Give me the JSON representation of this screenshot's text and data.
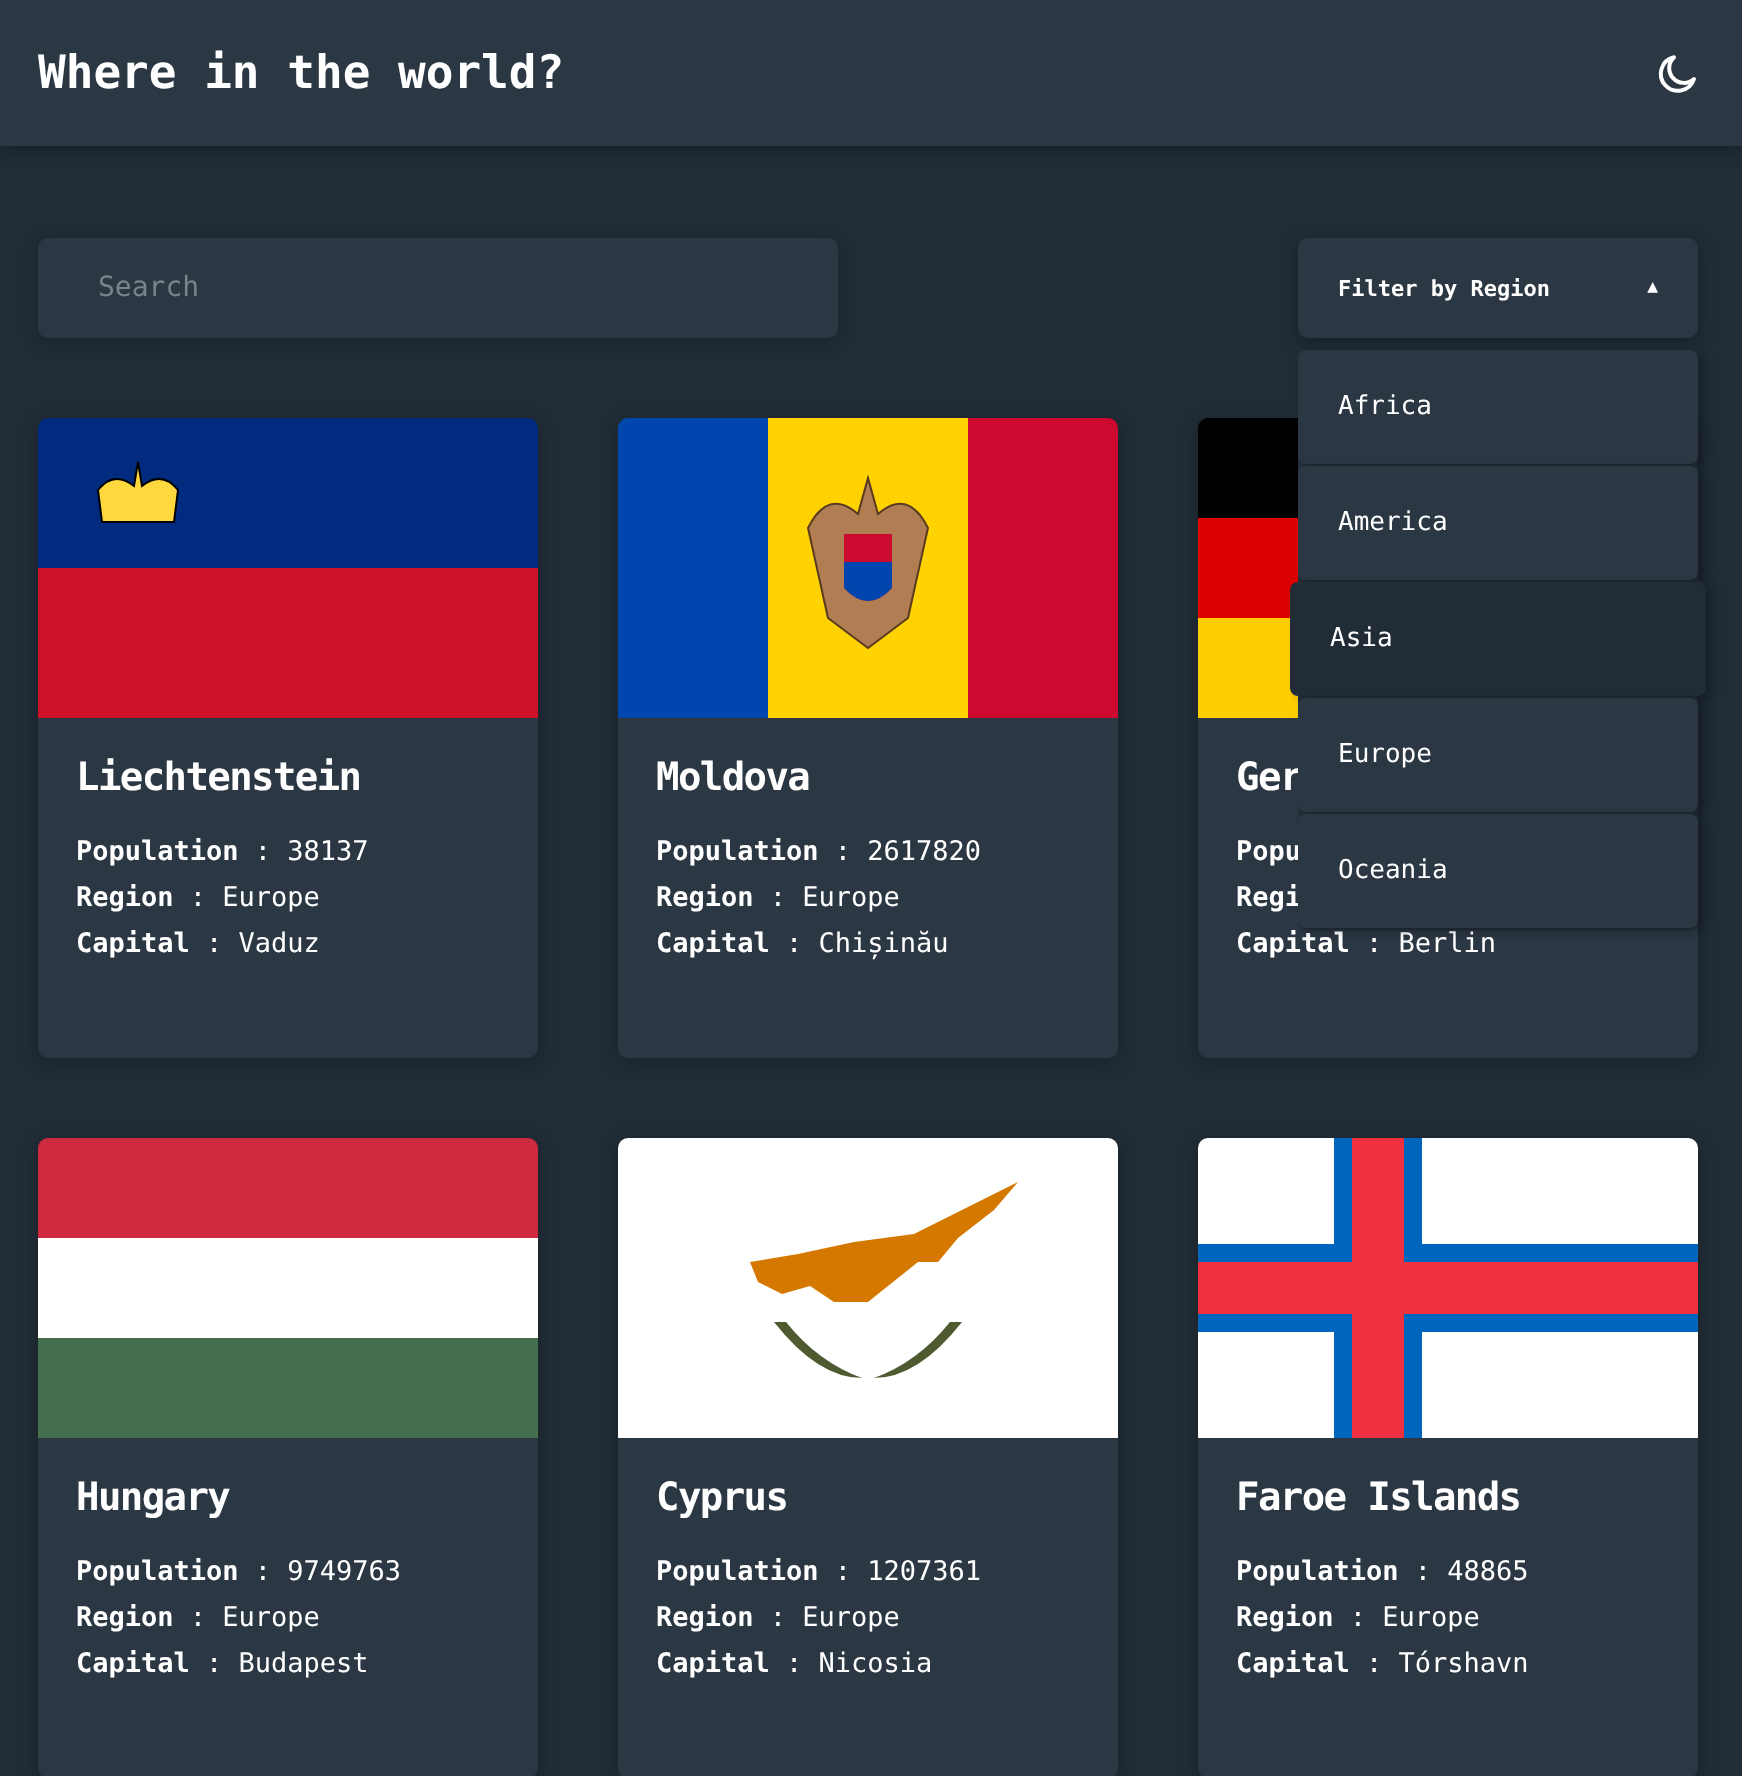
{
  "header": {
    "title": "Where in the world?"
  },
  "search": {
    "placeholder": "Search"
  },
  "filter": {
    "label": "Filter by Region",
    "expanded": true,
    "caret": "▲",
    "options": [
      {
        "label": "Africa",
        "selected": false
      },
      {
        "label": "America",
        "selected": false
      },
      {
        "label": "Asia",
        "selected": true
      },
      {
        "label": "Europe",
        "selected": false
      },
      {
        "label": "Oceania",
        "selected": false
      }
    ]
  },
  "countries": [
    {
      "name": "Liechtenstein",
      "lines": [
        "**Population** : 38137",
        "**Region** : Europe",
        "**Capital** : Vaduz"
      ]
    },
    {
      "name": "Moldova",
      "lines": [
        "**Population** : 2617820",
        "**Region** : Europe",
        "**Capital** : Chișinău"
      ]
    },
    {
      "name": "Ger",
      "lines": [
        "**Popu**",
        "**Regi**",
        "**Capital** : Berlin"
      ]
    },
    {
      "name": "Hungary",
      "lines": [
        "**Population** : 9749763",
        "**Region** : Europe",
        "**Capital** : Budapest"
      ]
    },
    {
      "name": "Cyprus",
      "lines": [
        "**Population** : 1207361",
        "**Region** : Europe",
        "**Capital** : Nicosia"
      ]
    },
    {
      "name": "Faroe Islands",
      "lines": [
        "**Population** : 48865",
        "**Region** : Europe",
        "**Capital** : Tórshavn"
      ]
    }
  ]
}
